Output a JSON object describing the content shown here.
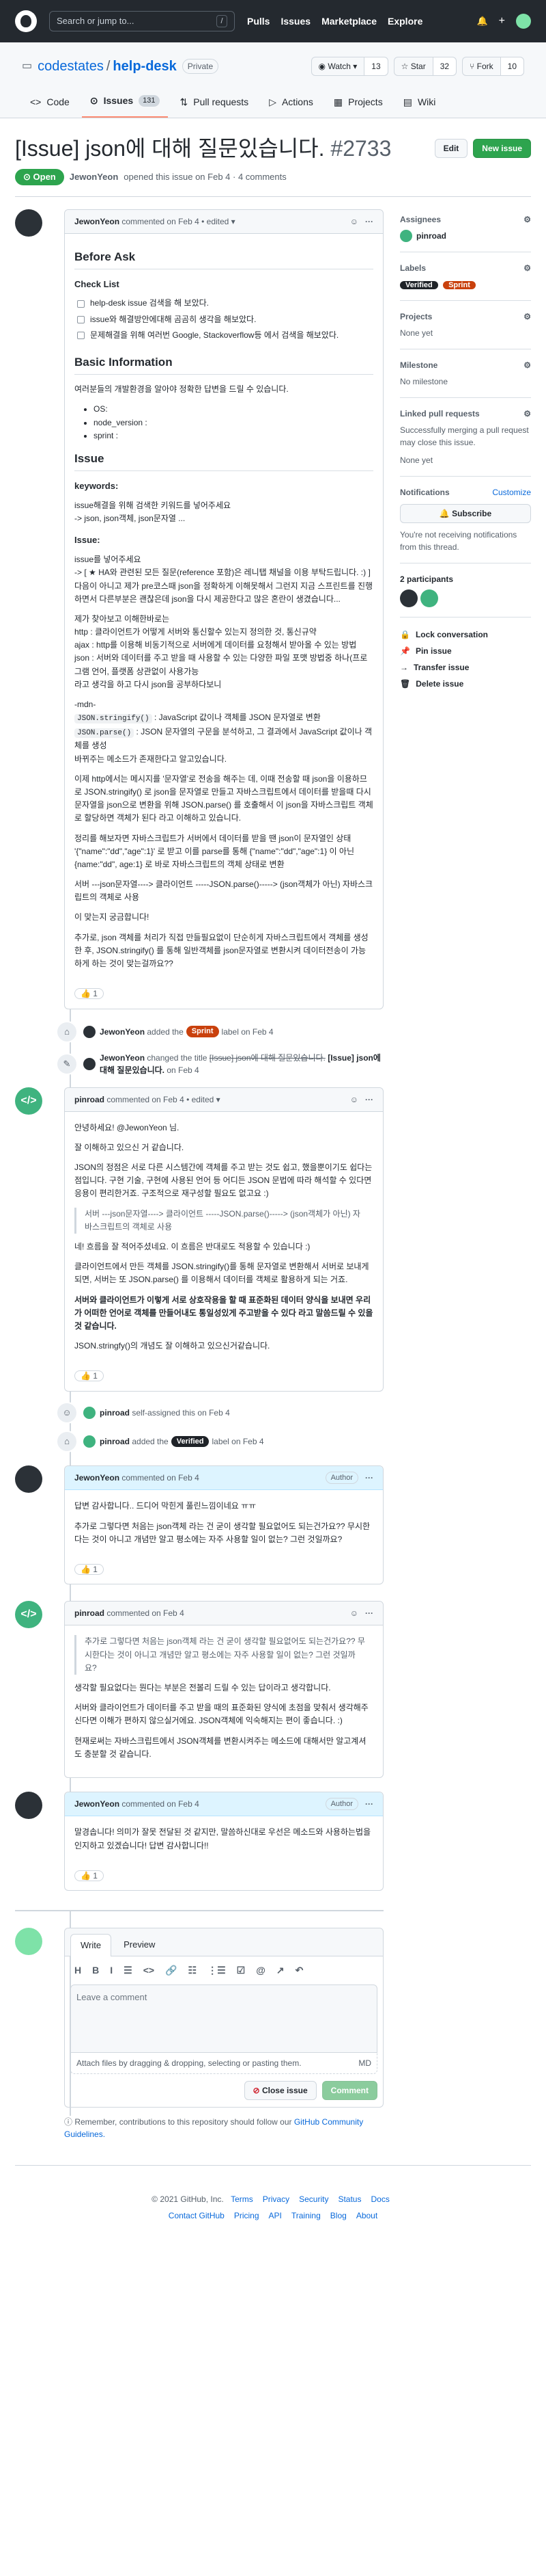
{
  "header": {
    "search_placeholder": "Search or jump to...",
    "search_key": "/",
    "nav": [
      "Pulls",
      "Issues",
      "Marketplace",
      "Explore"
    ],
    "bell": "🔔",
    "plus": "+"
  },
  "repo": {
    "owner": "codestates",
    "name": "help-desk",
    "visibility": "Private",
    "watch": "Watch",
    "watch_count": "13",
    "star": "Star",
    "star_count": "32",
    "fork": "Fork",
    "fork_count": "10"
  },
  "tabs": [
    {
      "label": "Code",
      "icon": "<>"
    },
    {
      "label": "Issues",
      "icon": "⊙",
      "count": "131"
    },
    {
      "label": "Pull requests",
      "icon": "⇅"
    },
    {
      "label": "Actions",
      "icon": "▷"
    },
    {
      "label": "Projects",
      "icon": "▦"
    },
    {
      "label": "Wiki",
      "icon": "▤"
    }
  ],
  "issue": {
    "title": "[Issue] json에 대해 질문있습니다.",
    "number": "#2733",
    "edit": "Edit",
    "new_issue": "New issue",
    "state": "Open",
    "author": "JewonYeon",
    "meta": "opened this issue on Feb 4 · 4 comments"
  },
  "c1": {
    "author": "JewonYeon",
    "meta": "commented on Feb 4 • edited",
    "h_before": "Before Ask",
    "h_checklist": "Check List",
    "checks": [
      "help-desk issue 검색을 해 보았다.",
      "issue와 해결방안에대해 곰곰히 생각을 해보았다.",
      "문제해결을 위해 여러번 Google, Stackoverflow등 에서 검색을 해보았다."
    ],
    "h_basic": "Basic Information",
    "basic_desc": "여러분들의 개발환경을 알아야 정확한 답변을 드릴 수 있습니다.",
    "basic_items": [
      "OS:",
      "node_version :",
      "sprint :"
    ],
    "h_issue": "Issue",
    "h_keywords": "keywords:",
    "kw1": "issue해결을 위해 검색한 키워드를 넣어주세요",
    "kw2": "-> json, json객체, json문자열 ...",
    "h_issue2": "Issue:",
    "p1": "issue를 넣어주세요",
    "p2": "-> [ ★ HA와 관련된 모든 질문(reference 포함)은 레니탭 채널을 이용 부탁드립니다. :) ]",
    "p3": "다음이 아니고 제가 pre코스때 json을 정확하게 이해못해서 그런지 지금 스프린트를 진행하면서 다른부분은 괜찮은데 json을 다시 제공한다고 많은 혼란이 생겼습니다...",
    "p4": "제가 찾아보고 이해한바로는",
    "p5": "http : 클라이언트가 어떻게 서버와 통신할수 있는지 정의한 것, 통신규약",
    "p6": "ajax : http를 이용해 비동기적으로 서버에게 데이터를 요청해서 받아올 수 있는 방법",
    "p7": "json : 서버와 데이터를 주고 받을 때 사용할 수 있는 다양한 파일 포맷 방법중 하나(프로그램 언어, 플랫폼 상관없이 사용가능",
    "p8": "라고 생각을 하고 다시 json을 공부하다보니",
    "p9": "-mdn-",
    "p10a": "JSON.stringify()",
    "p10b": " : JavaScript 값이나 객체를 JSON 문자열로 변환",
    "p11a": "JSON.parse()",
    "p11b": " : JSON 문자열의 구문을 분석하고, 그 결과에서 JavaScript 값이나 객체를 생성",
    "p12": "바뀌주는 메소드가 존재한다고 알고있습니다.",
    "p13": "이제 http에서는 메시지를 '문자열'로 전송을 해주는 데, 이때 전송할 때 json을 이용하므로 JSON.stringify() 로 json을 문자열로 만들고 자바스크립트에서 데이터를 받을때 다시 문자열을 json으로 변환을 위해 JSON.parse() 를 호출해서 이 json을 자바스크립트 객체로 할당하면 객체가 된다 라고 이해하고 있습니다.",
    "p14": "정리를 해보자면 자바스크립트가 서버에서 데이터를 받을 땐 json이 문자열인 상태 '{\"name\":\"dd\",\"age\":1}' 로 받고 이를 parse를 통해 {\"name\":\"dd\",\"age\":1} 이 아닌 {name:\"dd\", age:1} 로 바로 자바스크립트의 객체 상태로 변환",
    "p15": "서버 ---json문자열----> 클라이언트 -----JSON.parse()-----> (json객체가 아닌) 자바스크립트의 객체로 사용",
    "p16": "이 맞는지 궁금합니다!",
    "p17": "추가로, json 객체를 처리가 직접 만들필요없이 단순히게 자바스크립트에서 객체를 생성한 후, JSON.stringify() 를 통해 일반객체를 json문자열로 변환시켜 데이터전송이 가능하게 하는 것이 맞는걸까요??",
    "reaction": "👍 1"
  },
  "ev1": {
    "author": "JewonYeon",
    "a": "added the",
    "label": "Sprint",
    "b": "label on Feb 4"
  },
  "ev2": {
    "author": "JewonYeon",
    "text": "changed the title",
    "old": "[Issue] json에 대해 질문있습니다.",
    "new": "[Issue] json에 대해 질문있습니다.",
    "when": "on Feb 4"
  },
  "c2": {
    "author": "pinroad",
    "meta": "commented on Feb 4 • edited",
    "p1": "안녕하세요! @JewonYeon 님.",
    "p2": "잘 이해하고 있으신 거 같습니다.",
    "p3": "JSON의 정점은 서로 다른 시스템간에 객체를 주고 받는 것도 쉽고, 했을뿐이기도 쉽다는 점입니다. 구현 기술, 구현에 사용된 언어 등 어디든 JSON 문법에 따라 해석할 수 있다면 응용이 편리한거죠. 구조적으로 재구성할 필요도 없고요 :)",
    "quote": "서버 ---json문자열----> 클라이언트 -----JSON.parse()-----> (json객체가 아닌) 자바스크립트의 객체로 사용",
    "p4": "네! 흐름을 잘 적어주셨네요. 이 흐름은 반대로도 적용할 수 있습니다 :)",
    "p5": "클라이언트에서 만든 객체를 JSON.stringify()를 통해 문자열로 변환해서 서버로 보내게되면, 서버는 또 JSON.parse() 를 이용해서 데이터를 객체로 활용하게 되는 거죠.",
    "p6": "서버와 클라이언트가 이렇게 서로 상호작용을 할 때 표준화된 데이터 양식을 보내면 우리가 어떠한 언어로 객체를 만들어내도 통일성있게 주고받을 수 있다 라고 말씀드릴 수 있을 것 같습니다.",
    "p7": "JSON.stringfy()의 개념도 잘 이해하고 있으신거같습니다.",
    "reaction": "👍 1"
  },
  "ev3": {
    "author": "pinroad",
    "text": "self-assigned this on Feb 4"
  },
  "ev4": {
    "author": "pinroad",
    "a": "added the",
    "label": "Verified",
    "b": "label on Feb 4"
  },
  "c3": {
    "author": "JewonYeon",
    "meta": "commented on Feb 4",
    "role": "Author",
    "p1": "답변 감사합니다.. 드디어 막힌게 풀린느낌이네요 ㅠㅠ",
    "p2": "추가로 그렇다면 처음는 json객체 라는 건 굳이 생각할 필요없어도 되는건가요?? 무시한다는 것이 아니고 개념만 알고 평소에는 자주 사용할 일이 없는? 그런 것일까요?",
    "reaction": "👍 1"
  },
  "c4": {
    "author": "pinroad",
    "meta": "commented on Feb 4",
    "quote": "추가로 그렇다면 처음는 json객체 라는 건 굳이 생각할 필요없어도 되는건가요?? 무시한다는 것이 아니고 개념만 알고 평소에는 자주 사용할 일이 없는? 그런 것일까요?",
    "p1": "생각할 필요없다는 뭔다는 부분은 전볼리 드릴 수 있는 답이라고 생각합니다.",
    "p2": "서버와 클라이언트가 데이터를 주고 받을 때의 표준화된 양식에 초점을 맞춰서 생각해주신다면 이해가 편하지 않으실거에요. JSON객체에 익숙해지는 편이 좋습니다. :)",
    "p3": "현재로써는 자바스크립트에서 JSON객체를 변환시켜주는 메소드에 대해서만 알고계셔도 충분할 것 같습니다."
  },
  "c5": {
    "author": "JewonYeon",
    "meta": "commented on Feb 4",
    "role": "Author",
    "p1": "말경솝니다! 의미가 잘못 전달된 것 같지만, 말씀하신대로 우선은 메소드와 사용하는법을 인지하고 있겠습니다! 답변 감사합니다!!",
    "reaction": "👍 1"
  },
  "editor": {
    "write": "Write",
    "preview": "Preview",
    "tools": [
      "H",
      "B",
      "I",
      "☰",
      "<>",
      "🔗",
      "☷",
      "⋮☰",
      "☑",
      "@",
      "↗",
      "↶"
    ],
    "placeholder": "Leave a comment",
    "attach": "Attach files by dragging & dropping, selecting or pasting them.",
    "md": "MD",
    "close": "Close issue",
    "comment": "Comment",
    "note_a": "Remember, contributions to this repository should follow our",
    "note_link": "GitHub Community Guidelines."
  },
  "sidebar": {
    "assignees": "Assignees",
    "assignee": "pinroad",
    "labels": "Labels",
    "label1": "Verified",
    "label2": "Sprint",
    "projects": "Projects",
    "projects_val": "None yet",
    "milestone": "Milestone",
    "milestone_val": "No milestone",
    "linked": "Linked pull requests",
    "linked_desc": "Successfully merging a pull request may close this issue.",
    "linked_val": "None yet",
    "notifications": "Notifications",
    "customize": "Customize",
    "subscribe": "Subscribe",
    "notif_desc": "You're not receiving notifications from this thread.",
    "participants": "2 participants",
    "lock": "Lock conversation",
    "pin": "Pin issue",
    "transfer": "Transfer issue",
    "delete": "Delete issue"
  },
  "footer": {
    "copy": "© 2021 GitHub, Inc.",
    "row1": [
      "Terms",
      "Privacy",
      "Security",
      "Status",
      "Docs"
    ],
    "row2": [
      "Contact GitHub",
      "Pricing",
      "API",
      "Training",
      "Blog",
      "About"
    ]
  },
  "colors": {
    "verified": "#1f2328",
    "sprint": "#c9410d",
    "open": "#2da44e"
  }
}
